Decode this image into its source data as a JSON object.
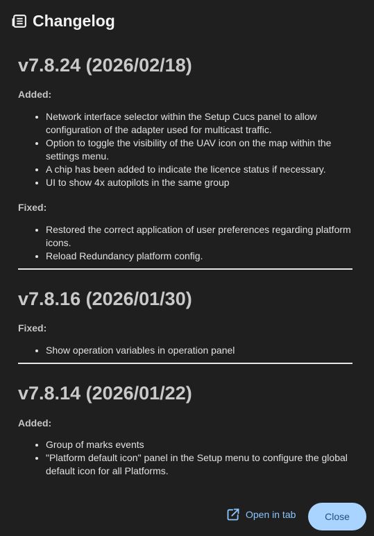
{
  "dialog": {
    "title": "Changelog",
    "title_icon": "newspaper-icon"
  },
  "changelog": [
    {
      "version": "v7.8.24 (2026/02/18)",
      "sections": [
        {
          "title": "Added:",
          "items": [
            "Network interface selector within the Setup Cucs panel to allow configuration of the adapter used for multicast traffic.",
            "Option to toggle the visibility of the UAV icon on the map within the settings menu.",
            "A chip has been added to indicate the licence status if necessary.",
            "UI to show 4x autopilots in the same group"
          ]
        },
        {
          "title": "Fixed:",
          "items": [
            "Restored the correct application of user preferences regarding platform icons.",
            "Reload Redundancy platform config."
          ]
        }
      ]
    },
    {
      "version": "v7.8.16 (2026/01/30)",
      "sections": [
        {
          "title": "Fixed:",
          "items": [
            "Show operation variables in operation panel"
          ]
        }
      ]
    },
    {
      "version": "v7.8.14 (2026/01/22)",
      "sections": [
        {
          "title": "Added:",
          "items": [
            "Group of marks events",
            "\"Platform default icon\" panel in the Setup menu to configure the global default icon for all Platforms."
          ]
        }
      ]
    }
  ],
  "footer": {
    "open_in_tab_label": "Open in tab",
    "open_in_tab_icon": "external-link-icon",
    "close_label": "Close"
  },
  "colors": {
    "background": "#1f1f1f",
    "accent_link": "#8cc6ff",
    "close_button_bg": "#a8d4ff",
    "close_button_text": "#1f4f7e"
  }
}
